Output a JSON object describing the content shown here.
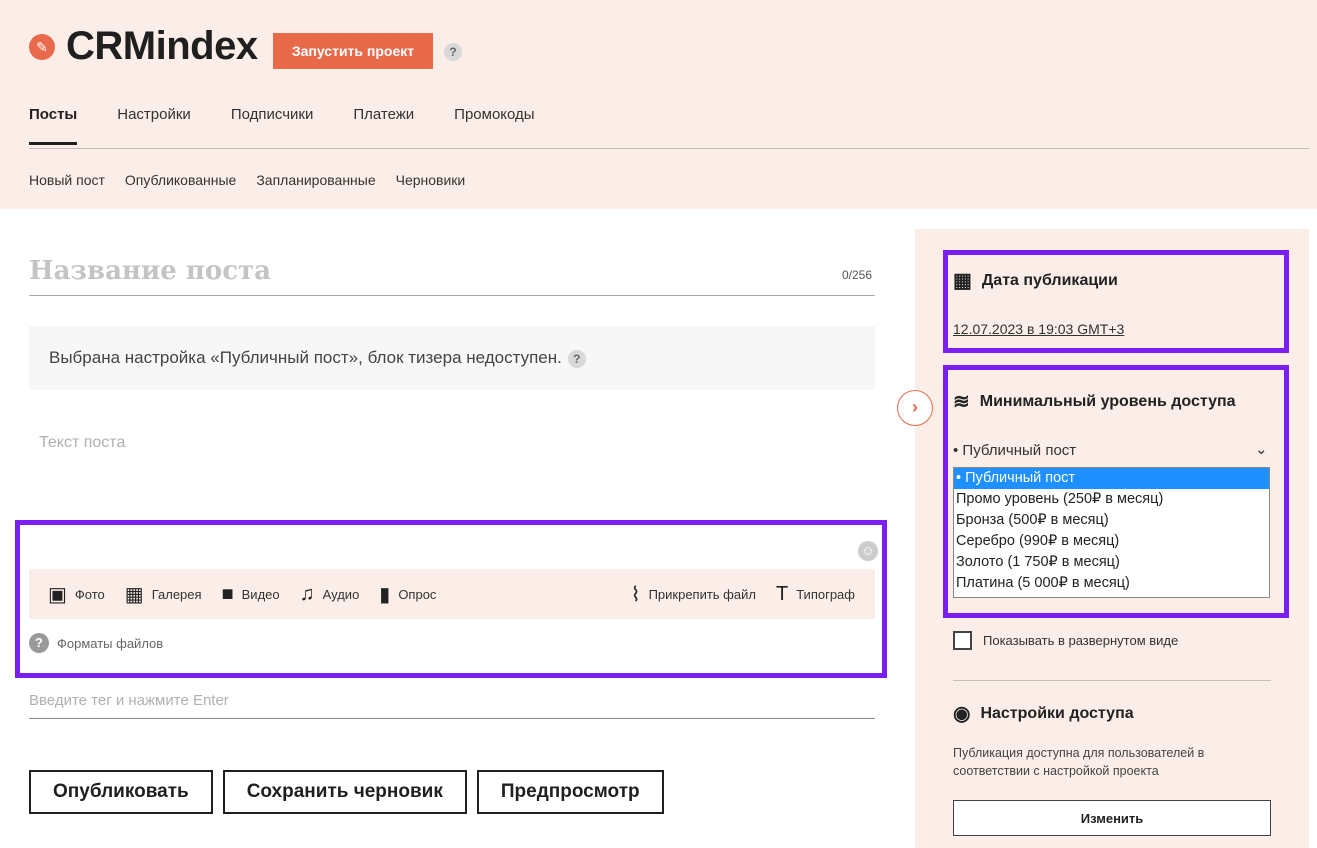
{
  "header": {
    "app_title": "CRMindex",
    "launch_label": "Запустить проект",
    "help": "?",
    "tabs": [
      {
        "label": "Посты",
        "active": true
      },
      {
        "label": "Настройки"
      },
      {
        "label": "Подписчики"
      },
      {
        "label": "Платежи"
      },
      {
        "label": "Промокоды"
      }
    ],
    "subtabs": [
      {
        "label": "Новый пост"
      },
      {
        "label": "Опубликованные"
      },
      {
        "label": "Запланированные"
      },
      {
        "label": "Черновики"
      }
    ]
  },
  "editor": {
    "title_placeholder": "Название поста",
    "title_counter": "0/256",
    "notice": "Выбрана настройка «Публичный пост», блок тизера недоступен.",
    "notice_help": "?",
    "body_placeholder": "Текст поста",
    "toolbar": {
      "photo": "Фото",
      "gallery": "Галерея",
      "video": "Видео",
      "audio": "Аудио",
      "poll": "Опрос",
      "attach": "Прикрепить файл",
      "typograph": "Типограф"
    },
    "formats_label": "Форматы файлов",
    "tag_placeholder": "Введите тег и нажмите Enter"
  },
  "actions": {
    "publish": "Опубликовать",
    "save_draft": "Сохранить черновик",
    "preview": "Предпросмотр"
  },
  "sidebar": {
    "date_heading": "Дата публикации",
    "date_value": "12.07.2023 в 19:03 GMT+3",
    "access_heading": "Минимальный уровень доступа",
    "access_selected": "Публичный пост",
    "access_options": [
      "Публичный пост",
      "Промо уровень (250₽ в месяц)",
      "Бронза (500₽ в месяц)",
      "Серебро (990₽ в месяц)",
      "Золото (1 750₽ в месяц)",
      "Платина (5 000₽ в месяц)"
    ],
    "show_expanded_label": "Показывать в развернутом виде",
    "access_settings_heading": "Настройки доступа",
    "access_settings_desc": "Публикация доступна для пользователей в соответствии с настройкой проекта",
    "change_label": "Изменить"
  }
}
